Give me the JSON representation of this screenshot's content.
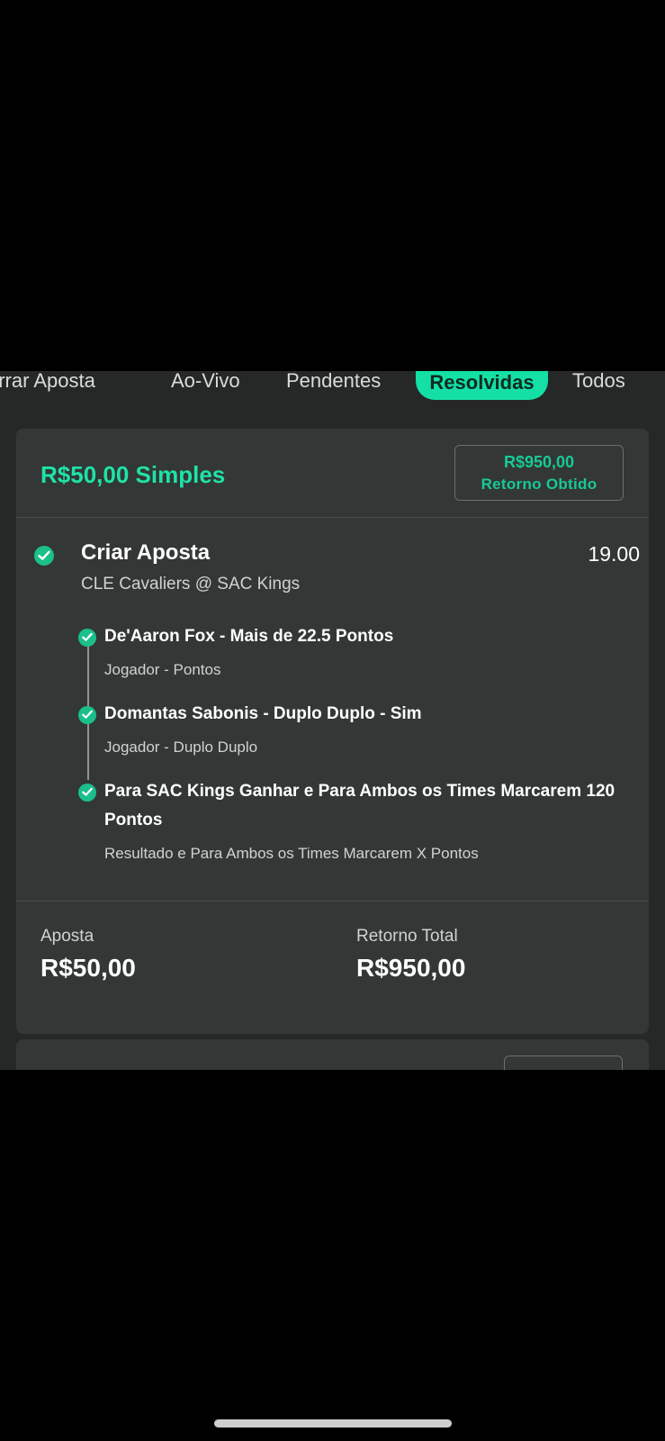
{
  "tabs": [
    {
      "label": "errar Aposta",
      "active": false
    },
    {
      "label": "Ao-Vivo",
      "active": false
    },
    {
      "label": "Pendentes",
      "active": false
    },
    {
      "label": "Resolvidas",
      "active": true
    },
    {
      "label": "Todos",
      "active": false
    }
  ],
  "card": {
    "stake_title": "R$50,00 Simples",
    "return_amount": "R$950,00",
    "return_caption": "Retorno Obtido",
    "bet_title": "Criar Aposta",
    "odds": "19.00",
    "match": "CLE Cavaliers @ SAC Kings",
    "legs": [
      {
        "name": "De'Aaron Fox - Mais de 22.5 Pontos",
        "market": "Jogador - Pontos"
      },
      {
        "name": "Domantas Sabonis - Duplo Duplo - Sim",
        "market": "Jogador - Duplo Duplo"
      },
      {
        "name": "Para SAC Kings Ganhar e Para Ambos os Times Marcarem 120 Pontos",
        "market": "Resultado e Para Ambos os Times Marcarem X Pontos"
      }
    ],
    "stake_label": "Aposta",
    "stake_value": "R$50,00",
    "total_return_label": "Retorno Total",
    "total_return_value": "R$950,00"
  },
  "colors": {
    "accent": "#14e0a6",
    "card_bg": "#333735",
    "app_bg": "#262827",
    "check": "#1bbf8a"
  }
}
